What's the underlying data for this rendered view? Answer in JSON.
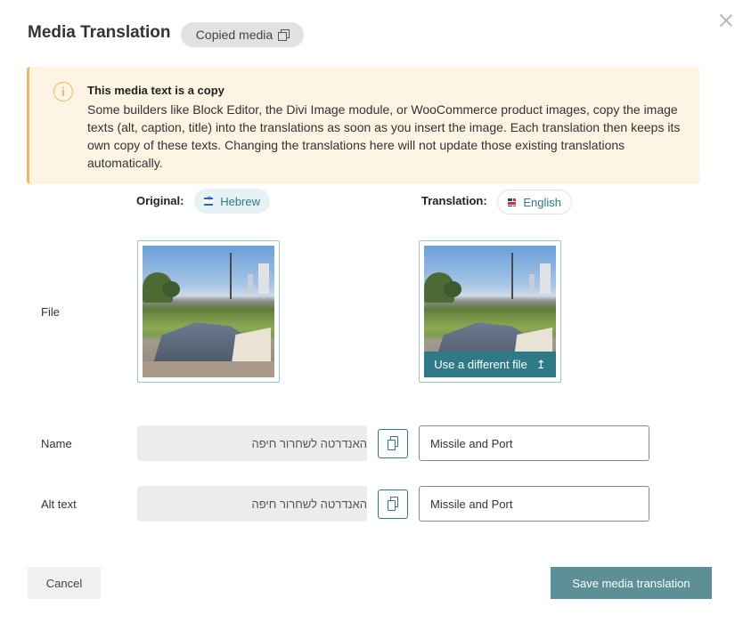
{
  "dialog": {
    "title": "Media Translation",
    "badge": "Copied media",
    "close_icon": "close-icon"
  },
  "notice": {
    "icon": "info-icon",
    "icon_glyph": "i",
    "title": "This media text is a copy",
    "body": "Some builders like Block Editor, the Divi Image module, or WooCommerce product images, copy the image texts (alt, caption, title) into the translations as soon as you insert the image. Each translation then keeps its own copy of these texts. Changing the translations here will not update those existing translations automatically."
  },
  "columns": {
    "original_label": "Original:",
    "original_language": "Hebrew",
    "translation_label": "Translation:",
    "translation_language": "English"
  },
  "file_row": {
    "label": "File",
    "replace_button": "Use a different file",
    "replace_icon": "upload-icon",
    "replace_glyph": "↥"
  },
  "name_row": {
    "label": "Name",
    "original_value": "האנדרטה לשחרור חיפה",
    "translation_value": "Missile and Port"
  },
  "alt_row": {
    "label": "Alt text",
    "original_value": "האנדרטה לשחרור חיפה",
    "translation_value": "Missile and Port"
  },
  "footer": {
    "cancel": "Cancel",
    "save": "Save media translation"
  },
  "colors": {
    "accent": "#2e7a87",
    "notice_bg": "#fdf4e3",
    "notice_border": "#f0b85f",
    "save_button": "#5d8f97"
  }
}
